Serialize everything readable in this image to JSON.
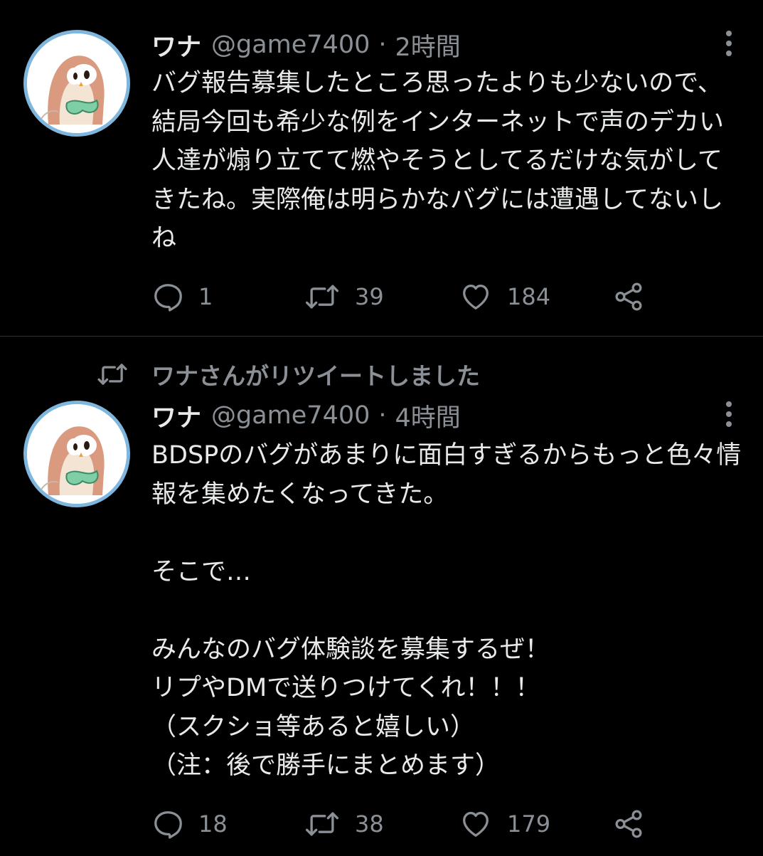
{
  "theme": {
    "background": "#000000",
    "text": "#e7e9ea",
    "secondary_text": "#8b9096",
    "divider": "#2f3336",
    "avatar_ring": "#7fb6de"
  },
  "tweets": [
    {
      "retweet_context": null,
      "author": {
        "display_name": "ワナ",
        "handle": "@game7400",
        "avatar_icon": "owl-character-avatar"
      },
      "separator": "·",
      "time": "2時間",
      "text": "バグ報告募集したところ思ったよりも少ないので、結局今回も希少な例をインターネットで声のデカい人達が煽り立てて燃やそうとしてるだけな気がしてきたね。実際俺は明らかなバグには遭遇してないしね",
      "actions": {
        "reply": {
          "icon": "reply-icon",
          "count": "1"
        },
        "retweet": {
          "icon": "retweet-icon",
          "count": "39"
        },
        "like": {
          "icon": "heart-icon",
          "count": "184"
        },
        "share": {
          "icon": "share-icon"
        }
      }
    },
    {
      "retweet_context": {
        "icon": "retweet-icon",
        "label": "ワナさんがリツイートしました"
      },
      "author": {
        "display_name": "ワナ",
        "handle": "@game7400",
        "avatar_icon": "owl-character-avatar"
      },
      "separator": "·",
      "time": "4時間",
      "text": "BDSPのバグがあまりに面白すぎるからもっと色々情報を集めたくなってきた。\n\nそこで…\n\nみんなのバグ体験談を募集するぜ！\nリプやDMで送りつけてくれ！！！\n（スクショ等あると嬉しい）\n（注：後で勝手にまとめます）",
      "actions": {
        "reply": {
          "icon": "reply-icon",
          "count": "18"
        },
        "retweet": {
          "icon": "retweet-icon",
          "count": "38"
        },
        "like": {
          "icon": "heart-icon",
          "count": "179"
        },
        "share": {
          "icon": "share-icon"
        }
      }
    }
  ]
}
